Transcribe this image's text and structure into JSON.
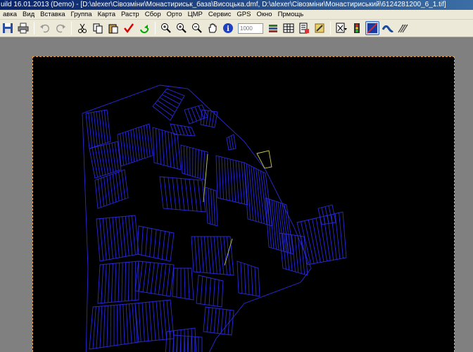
{
  "window": {
    "title": "uild 16.01.2013 (Demo) - [D:\\alexer\\Сівозміни\\Монастириськ_база\\Висоцька.dmf, D:\\alexer\\Сівозміни\\Монастириський\\6124281200_6_1.tif]"
  },
  "menu": [
    {
      "id": "file",
      "label": "авка"
    },
    {
      "id": "view",
      "label": "Вид"
    },
    {
      "id": "insert",
      "label": "Вставка"
    },
    {
      "id": "group",
      "label": "Группа"
    },
    {
      "id": "map",
      "label": "Карта"
    },
    {
      "id": "raster",
      "label": "Растр"
    },
    {
      "id": "collect",
      "label": "Сбор"
    },
    {
      "id": "ortho",
      "label": "Орто"
    },
    {
      "id": "dem",
      "label": "ЦМР"
    },
    {
      "id": "service",
      "label": "Сервис"
    },
    {
      "id": "gps",
      "label": "GPS"
    },
    {
      "id": "window",
      "label": "Окно"
    },
    {
      "id": "help",
      "label": "Пpмощь"
    }
  ],
  "toolbar": {
    "scale_placeholder": "1000",
    "buttons": [
      {
        "name": "save-icon"
      },
      {
        "name": "print-icon"
      },
      {
        "name": "undo-icon"
      },
      {
        "name": "redo-icon"
      },
      {
        "name": "cut-icon"
      },
      {
        "name": "copy-icon"
      },
      {
        "name": "paste-icon"
      },
      {
        "name": "check-icon"
      },
      {
        "name": "refresh-icon"
      },
      {
        "name": "zoom-window-icon"
      },
      {
        "name": "zoom-in-icon"
      },
      {
        "name": "zoom-out-icon"
      },
      {
        "name": "pan-hand-icon"
      },
      {
        "name": "info-icon"
      }
    ],
    "buttons2": [
      {
        "name": "layers-icon"
      },
      {
        "name": "table-icon"
      },
      {
        "name": "report-icon"
      },
      {
        "name": "tools-icon"
      },
      {
        "name": "select-mode-icon"
      },
      {
        "name": "traffic-light-icon"
      },
      {
        "name": "raster-toggle-icon"
      },
      {
        "name": "curve-icon"
      },
      {
        "name": "vector-arrows-icon"
      }
    ]
  },
  "colors": {
    "parcel_line": "#2a2ad8",
    "highlight_line": "#c8c850",
    "canvas_bg": "#000000",
    "workspace_bg": "#808080"
  }
}
